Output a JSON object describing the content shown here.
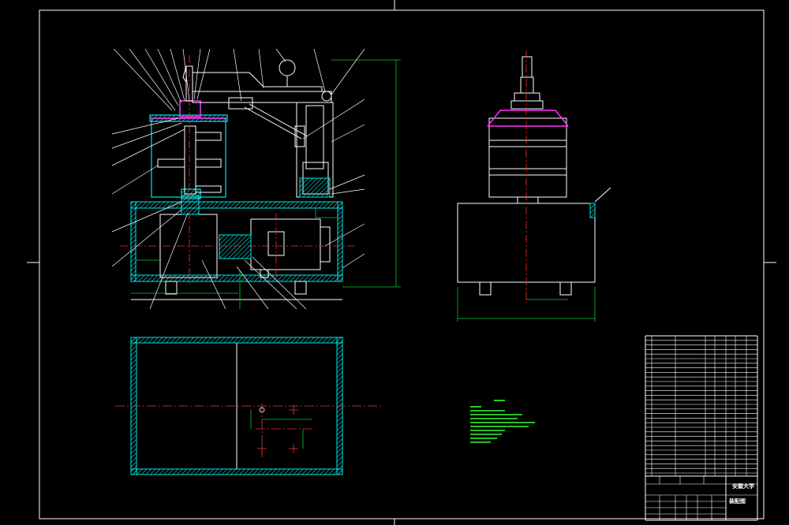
{
  "drawing": {
    "background_color": "#000000",
    "colors": {
      "outline": "#ffffff",
      "hatch": "#00e5e5",
      "center_line": "#ff2a2a",
      "dimension": "#00cc33",
      "highlight": "#ff33ff",
      "notes": "#33ff33"
    }
  },
  "title_block": {
    "school": "安徽大学",
    "drawing_name": "装配图"
  },
  "views": [
    {
      "name": "front-section-view"
    },
    {
      "name": "side-view"
    },
    {
      "name": "base-plan-view"
    }
  ]
}
